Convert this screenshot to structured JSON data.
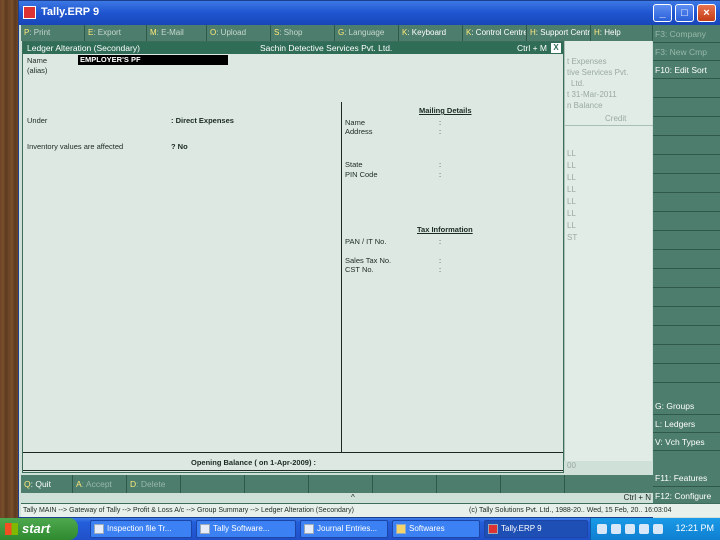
{
  "window": {
    "title": "Tally.ERP 9"
  },
  "menubar": [
    {
      "key": "P",
      "label": ": Print",
      "on": false
    },
    {
      "key": "E",
      "label": ": Export",
      "on": false
    },
    {
      "key": "M",
      "label": ": E-Mail",
      "on": false
    },
    {
      "key": "O",
      "label": ": Upload",
      "on": false
    },
    {
      "key": "S",
      "label": ": Shop",
      "on": false
    },
    {
      "key": "G",
      "label": ": Language",
      "on": false
    },
    {
      "key": "K",
      "label": ": Keyboard",
      "on": true
    },
    {
      "key": "K",
      "label": ": Control Centre",
      "on": true
    },
    {
      "key": "H",
      "label": ": Support Centre",
      "on": true
    },
    {
      "key": "H",
      "label": ": Help",
      "on": true
    }
  ],
  "dialog": {
    "title": "Ledger Alteration (Secondary)",
    "company": "Sachin Detective Services Pvt. Ltd.",
    "shortcut": "Ctrl + M",
    "close": "X",
    "name_label": "Name",
    "name_value": "EMPLOYER'S PF",
    "alias_label": "(alias)",
    "under_label": "Under",
    "under_value": ": Direct Expenses",
    "inventory_label": "Inventory values are affected",
    "inventory_value": "? No",
    "mailing_title": "Mailing Details",
    "name2_label": "Name",
    "address_label": "Address",
    "state_label": "State",
    "pin_label": "PIN Code",
    "tax_title": "Tax Information",
    "pan_label": "PAN / IT No.",
    "sales_tax_label": "Sales Tax No.",
    "cst_label": "CST No.",
    "colon": ":",
    "opening_label": "Opening Balance   ( on 1-Apr-2009)  :"
  },
  "ghost": {
    "line1": "t Expenses",
    "line2": "tive Services Pvt.",
    "line3": "Ltd.",
    "line4": "t 31-Mar-2011",
    "line5": "n Balance",
    "credit": "Credit",
    "marks": [
      "LL",
      "LL",
      "LL",
      "LL",
      "LL",
      "LL",
      "LL",
      "ST"
    ],
    "bottom": "00"
  },
  "rightbar": {
    "f3": "F3: Company",
    "f3b": "F3: New Cmp",
    "f10": "F10: Edit Sort",
    "groups": "G: Groups",
    "ledgers": "L: Ledgers",
    "vchtypes": "V: Vch Types",
    "f11": "F11: Features",
    "f12": "F12: Configure"
  },
  "bottombar": [
    {
      "key": "Q",
      "label": ": Quit",
      "dim": false
    },
    {
      "key": "A",
      "label": ": Accept",
      "dim": true
    },
    {
      "key": "D",
      "label": ": Delete",
      "dim": true
    }
  ],
  "ctrl_n": "Ctrl + N",
  "up_arrow": "^",
  "statusbar": {
    "breadcrumb": "Tally MAIN   --> Gateway of Tally   --> Profit & Loss A/c   --> Group Summary   --> Ledger Alteration (Secondary)",
    "copyright": "(c) Tally Solutions Pvt. Ltd., 1988-20..  Wed, 15 Feb, 20..  16:03:04"
  },
  "taskbar": {
    "start": "start",
    "tasks": [
      {
        "label": "Inspection file Tr..."
      },
      {
        "label": "Tally Software..."
      },
      {
        "label": "Journal Entries..."
      },
      {
        "label": "Softwares"
      },
      {
        "label": "Tally.ERP 9",
        "active": true
      }
    ],
    "clock": "12:21 PM"
  }
}
